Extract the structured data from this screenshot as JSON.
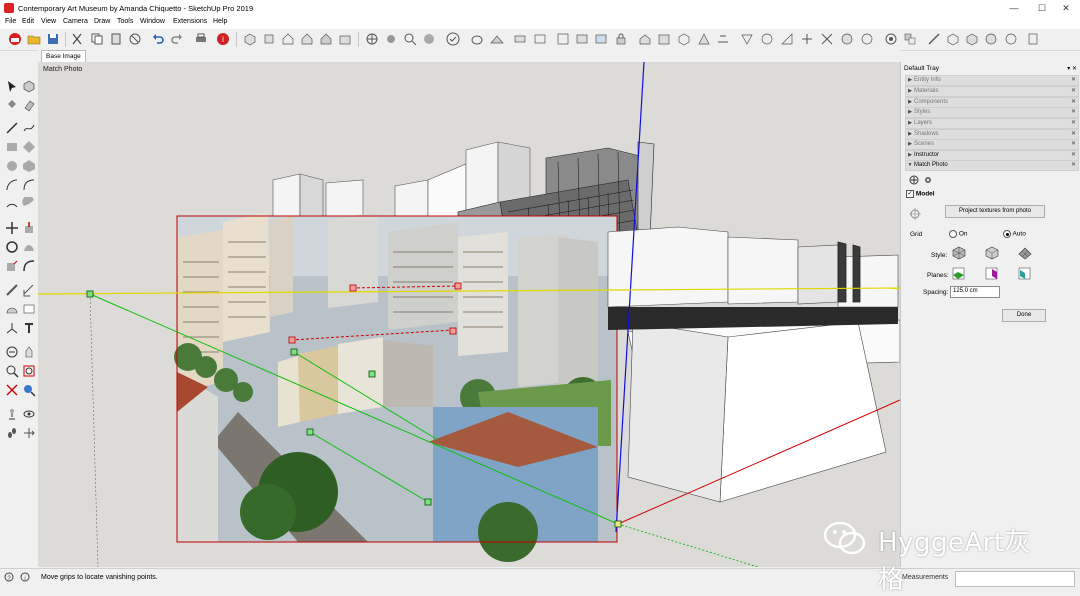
{
  "window": {
    "title": "Contemporary Art Museum by Amanda Chiquetto - SketchUp Pro 2019",
    "controls": [
      "—",
      "☐",
      "✕"
    ]
  },
  "menu": [
    "File",
    "Edit",
    "View",
    "Camera",
    "Draw",
    "Tools",
    "Window",
    "Extensions",
    "Help"
  ],
  "scene_tab": "Base Image",
  "viewport": {
    "label": "Match Photo"
  },
  "tray": {
    "title": "Default Tray",
    "pin": "▾ ✕",
    "panels": [
      {
        "label": "Entity Info",
        "open": false
      },
      {
        "label": "Materials",
        "open": false
      },
      {
        "label": "Components",
        "open": false
      },
      {
        "label": "Styles",
        "open": false
      },
      {
        "label": "Layers",
        "open": false
      },
      {
        "label": "Shadows",
        "open": false
      },
      {
        "label": "Scenes",
        "open": false
      },
      {
        "label": "Instructor",
        "open": false
      },
      {
        "label": "Match Photo",
        "open": true
      }
    ],
    "match_photo": {
      "model_label": "Model",
      "project_button": "Project textures from photo",
      "grid_label": "Grid",
      "grid_on": "On",
      "grid_auto": "Auto",
      "style_label": "Style:",
      "planes_label": "Planes:",
      "spacing_label": "Spacing:",
      "spacing_value": "125.0 cm",
      "done_button": "Done"
    }
  },
  "status": {
    "message": "Move grips to locate vanishing points.",
    "measurements_label": "Measurements"
  },
  "watermark": {
    "text": "HyggeArt灰格"
  },
  "colors": {
    "axis_red": "#d00000",
    "axis_green": "#00aa00",
    "axis_blue": "#1010dd",
    "horizon_yellow": "#e0d800",
    "viewport_bg": "#dcdbd8"
  }
}
